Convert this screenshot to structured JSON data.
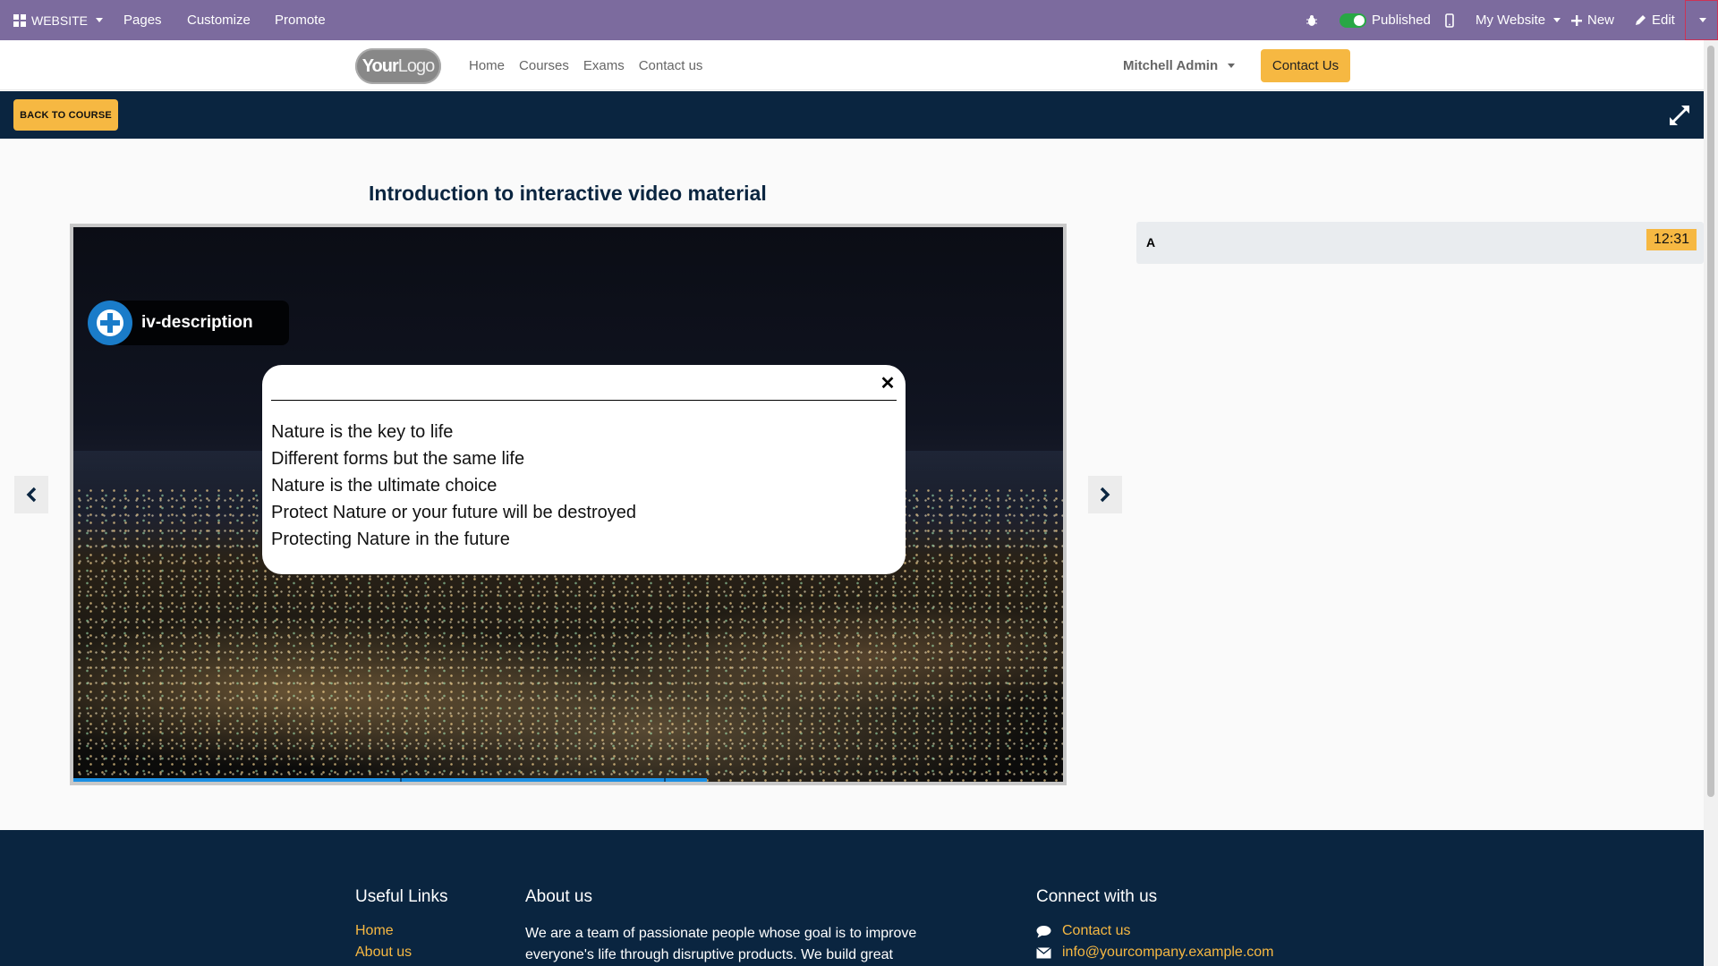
{
  "adminbar": {
    "website_label": "WEBSITE",
    "pages_label": "Pages",
    "customize_label": "Customize",
    "promote_label": "Promote",
    "published_label": "Published",
    "site_label": "My Website",
    "new_label": "New",
    "edit_label": "Edit"
  },
  "header": {
    "logo_text_bold": "Your",
    "logo_text_light": "Logo",
    "nav": [
      "Home",
      "Courses",
      "Exams",
      "Contact us"
    ],
    "user_name": "Mitchell Admin",
    "contact_button": "Contact Us"
  },
  "coursebar": {
    "back_label": "BACK TO COURSE"
  },
  "slide": {
    "title": "Introduction to interactive video material",
    "iv_label": "iv-description",
    "popup_items": [
      "Nature is the key to life",
      "Different forms but the same life",
      "Nature is the ultimate choice",
      "Protect Nature or your future will be destroyed",
      "Protecting Nature in the future"
    ],
    "progress_fraction": 0.64
  },
  "interactions": [
    {
      "label": "A",
      "time": "12:31"
    }
  ],
  "footer": {
    "useful_links_title": "Useful Links",
    "useful_links": [
      "Home",
      "About us"
    ],
    "about_title": "About us",
    "about_text": "We are a team of passionate people whose goal is to improve everyone's life through disruptive products. We build great",
    "connect_title": "Connect with us",
    "connect_links": [
      "Contact us",
      "info@yourcompany.example.com"
    ]
  },
  "colors": {
    "admin_bar": "#7c6b9e",
    "navy": "#0a2540",
    "accent": "#f6b842",
    "progress": "#1a8fe3"
  }
}
